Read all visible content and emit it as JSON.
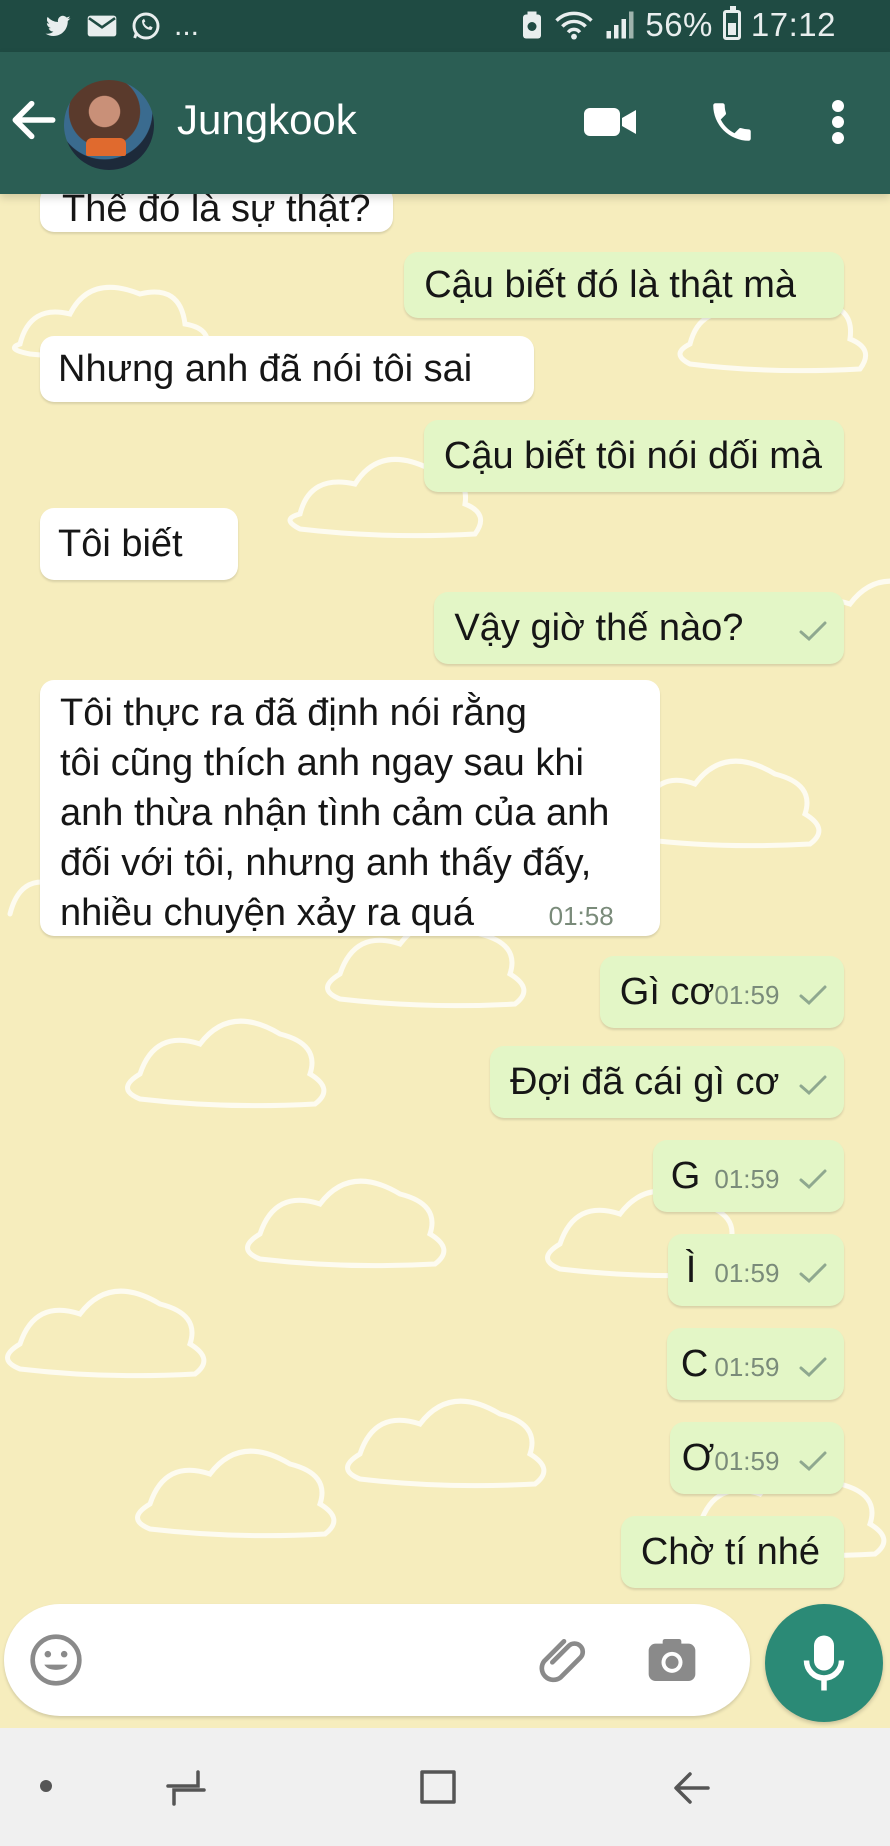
{
  "status_bar": {
    "notification_icons": [
      "twitter-icon",
      "mail-icon",
      "whatsapp-icon"
    ],
    "more_indicator": "...",
    "battery_percent": "56%",
    "time": "17:12"
  },
  "header": {
    "contact_name": "Jungkook",
    "icons": [
      "back-arrow-icon",
      "video-call-icon",
      "phone-call-icon",
      "more-options-icon"
    ]
  },
  "messages": [
    {
      "dir": "in",
      "text": "Thế đó là sự thật?"
    },
    {
      "dir": "out",
      "text": "Cậu biết đó là thật mà"
    },
    {
      "dir": "in",
      "text": "Nhưng anh đã nói tôi sai"
    },
    {
      "dir": "out",
      "text": "Cậu biết tôi nói dối mà"
    },
    {
      "dir": "in",
      "text": "Tôi biết"
    },
    {
      "dir": "out",
      "text": "Vậy giờ thế nào?",
      "tick": true
    },
    {
      "dir": "in",
      "lines": [
        "Tôi thực ra đã định nói rằng",
        "tôi cũng thích anh ngay sau khi",
        "anh thừa nhận tình cảm của anh",
        "đối với tôi, nhưng anh thấy đấy,",
        "nhiều chuyện xảy ra quá"
      ],
      "time": "01:58"
    },
    {
      "dir": "out",
      "text": "Gì cơ",
      "time": "01:59",
      "tick": true
    },
    {
      "dir": "out",
      "text": "Đợi đã cái gì cơ",
      "tick": true
    },
    {
      "dir": "out",
      "text": "G",
      "time": "01:59",
      "tick": true
    },
    {
      "dir": "out",
      "text": "Ì",
      "time": "01:59",
      "tick": true
    },
    {
      "dir": "out",
      "text": "C",
      "time": "01:59",
      "tick": true
    },
    {
      "dir": "out",
      "text": "Ơ",
      "time": "01:59",
      "tick": true
    },
    {
      "dir": "out",
      "text": "Chờ tí nhé"
    }
  ],
  "input": {
    "icons": [
      "emoji-icon",
      "attach-icon",
      "camera-icon",
      "microphone-icon"
    ]
  },
  "nav": {
    "icons": [
      "nav-dot-icon",
      "recent-apps-icon",
      "home-icon",
      "back-icon"
    ]
  },
  "colors": {
    "status_bar": "#1f4b43",
    "app_bar": "#2b5e54",
    "wallpaper": "#f6edbd",
    "incoming_bubble": "#ffffff",
    "outgoing_bubble": "#e3f6c6",
    "mic_button": "#2b8a76"
  }
}
